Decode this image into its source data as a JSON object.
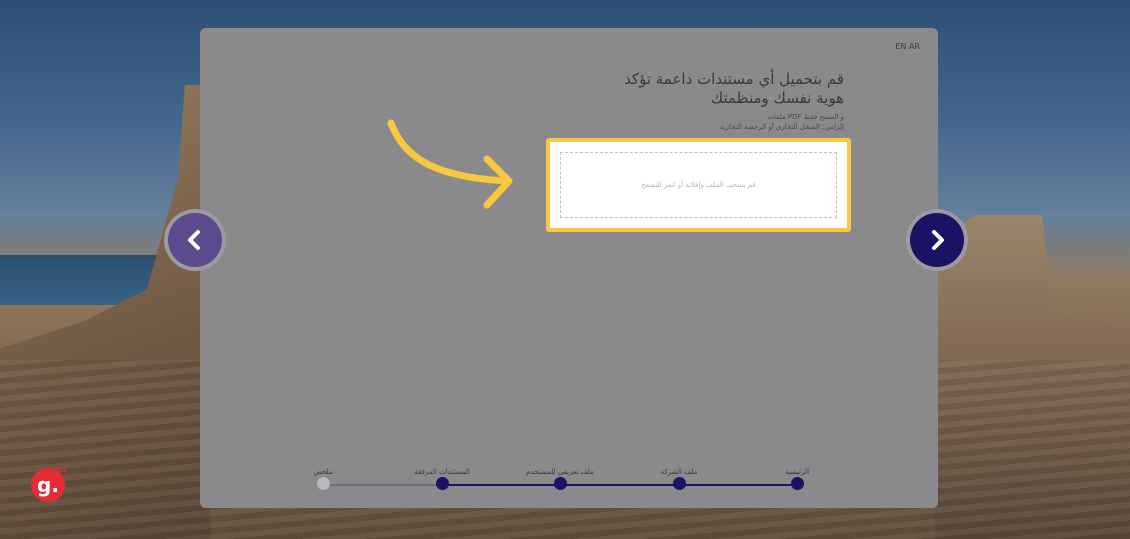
{
  "header": {
    "language_toggle": "EN AR"
  },
  "upload": {
    "title": "قم بتحميل أي مستندات داعمة تؤكد هوية نفسك ومنظمتك",
    "hint_line_1": "و المسح فقط PDF ملفات",
    "hint_line_2": "إلزامي: السجل التجاري أو الرخصة التجارية",
    "dropzone_text": "قم بسحب الملف وإفلاته أو انقر للتصفح"
  },
  "navigation": {
    "prev_icon": "chevron-left-icon",
    "next_icon": "chevron-right-icon"
  },
  "steps": [
    {
      "label": "الرئيسية",
      "state": "done"
    },
    {
      "label": "ملف الشركة",
      "state": "done"
    },
    {
      "label": "ملف تعريفي للمستخدم",
      "state": "done"
    },
    {
      "label": "المستندات المرفقة",
      "state": "done"
    },
    {
      "label": "ملخص",
      "state": "todo"
    }
  ],
  "brand": {
    "logo_letter": "g.",
    "logo_sup": "63"
  },
  "colors": {
    "accent": "#1b1464",
    "highlight": "#f7c840",
    "brand_red": "#e52b33"
  }
}
